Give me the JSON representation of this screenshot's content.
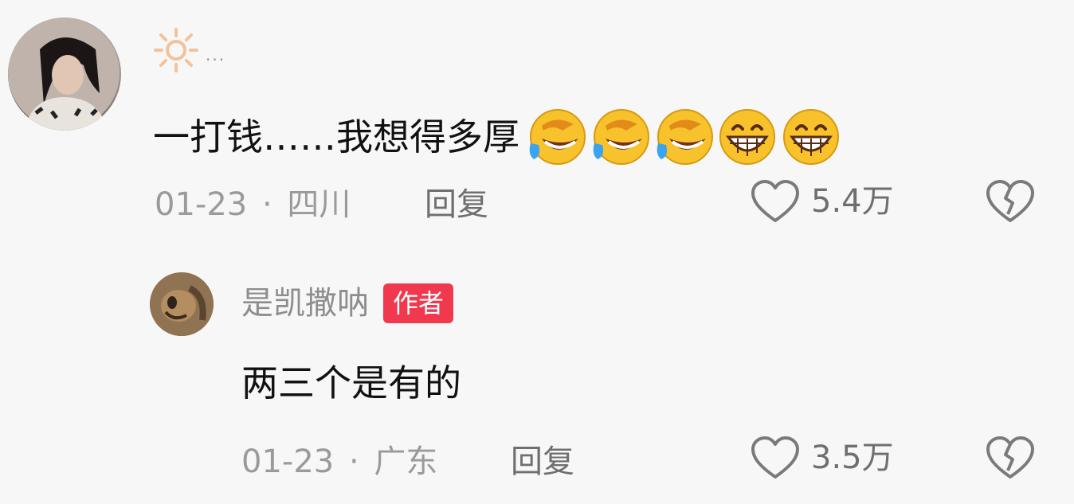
{
  "comments": [
    {
      "text": "一打钱……我想得多厚",
      "emojis": [
        "laughing-tears-emoji",
        "laughing-tears-emoji",
        "laughing-tears-emoji",
        "grinning-emoji",
        "grinning-emoji"
      ],
      "date": "01-23",
      "location": "四川",
      "separator": "·",
      "reply_label": "回复",
      "likes": "5.4万",
      "dots": "..."
    },
    {
      "username": "是凯撒呐",
      "badge": "作者",
      "text": "两三个是有的",
      "date": "01-23",
      "location": "广东",
      "separator": "·",
      "reply_label": "回复",
      "likes": "3.5万"
    }
  ],
  "colors": {
    "badge": "#f0384e",
    "meta_text": "#9a9a9a",
    "body_text": "#111111"
  }
}
